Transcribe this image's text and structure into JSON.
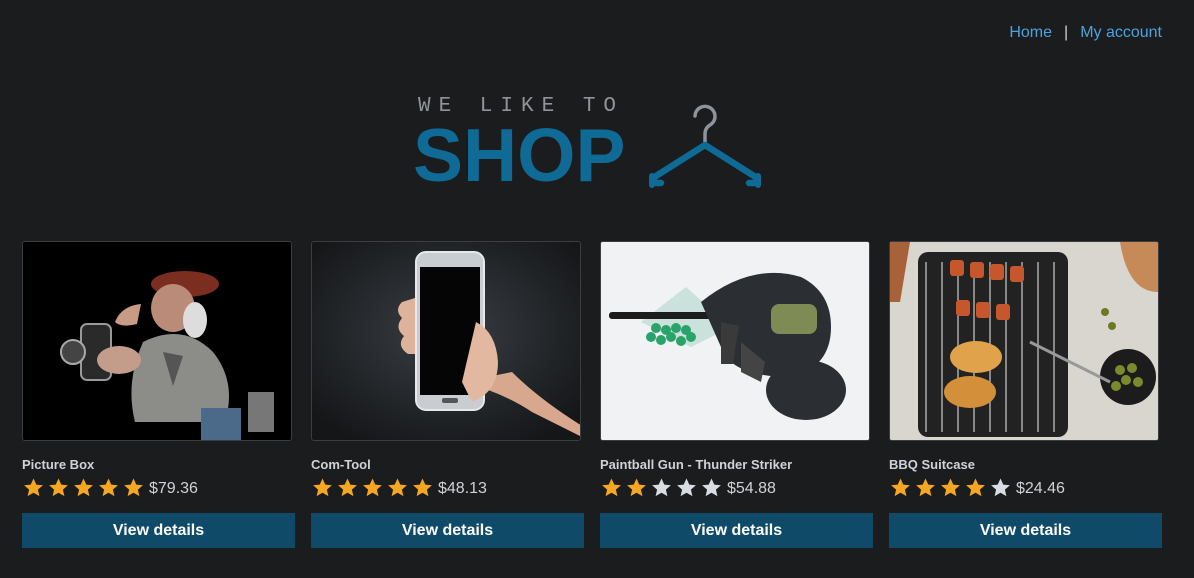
{
  "nav": {
    "home_label": "Home",
    "separator": "|",
    "account_label": "My account"
  },
  "logo": {
    "tagline": "WE LIKE TO",
    "word": "SHOP"
  },
  "colors": {
    "link": "#4aa3e0",
    "logo_word": "#0f6a95",
    "button_bg": "#0f4b69",
    "star_filled": "#f5a623",
    "star_empty": "#d8dde3"
  },
  "products": [
    {
      "name": "Picture Box",
      "rating": 5,
      "price": "$79.36",
      "button": "View details",
      "image": "old-photographer-figurine-image"
    },
    {
      "name": "Com-Tool",
      "rating": 5,
      "price": "$48.13",
      "button": "View details",
      "image": "hand-holding-smartphone-image"
    },
    {
      "name": "Paintball Gun - Thunder Striker",
      "rating": 2,
      "price": "$54.88",
      "button": "View details",
      "image": "paintball-gun-and-mask-image"
    },
    {
      "name": "BBQ Suitcase",
      "rating": 4,
      "price": "$24.46",
      "button": "View details",
      "image": "bbq-grill-with-skewers-image"
    }
  ]
}
